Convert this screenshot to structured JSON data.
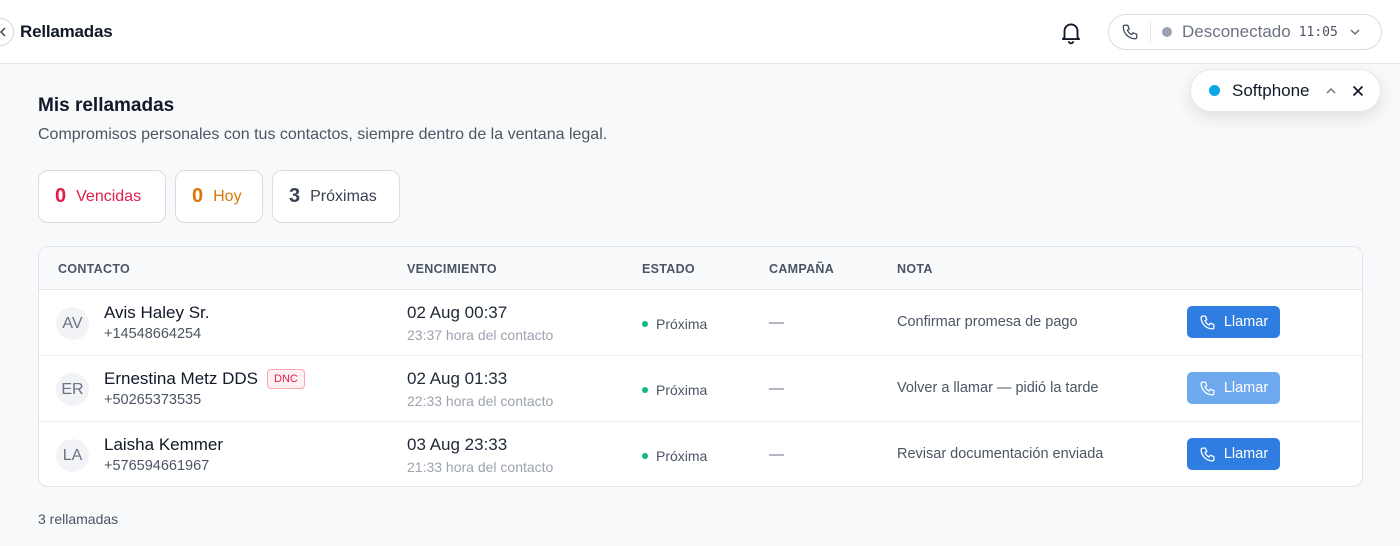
{
  "header": {
    "title": "Rellamadas",
    "connection_status": "Desconectado",
    "time": "11:05",
    "status_color": "#9aa3b2"
  },
  "softphone": {
    "label": "Softphone",
    "dot_color": "#0ea5e9"
  },
  "main": {
    "heading": "Mis rellamadas",
    "subtitle": "Compromisos personales con tus contactos, siempre dentro de la ventana legal."
  },
  "summary": [
    {
      "count": "0",
      "label": "Vencidas",
      "color": "#e11d48"
    },
    {
      "count": "0",
      "label": "Hoy",
      "color": "#d97706"
    },
    {
      "count": "3",
      "label": "Próximas",
      "color": "#374151"
    }
  ],
  "table": {
    "columns": {
      "contact": "CONTACTO",
      "due": "VENCIMIENTO",
      "status": "ESTADO",
      "campaign": "CAMPAÑA",
      "note": "NOTA"
    },
    "rows": [
      {
        "initials": "AV",
        "name": "Avis Haley Sr.",
        "dnc": "",
        "phone": "+14548664254",
        "due": "02 Aug 00:37",
        "local_time": "23:37 hora del contacto",
        "status": "Próxima",
        "campaign": "—",
        "note": "Confirmar promesa de pago",
        "action": "Llamar",
        "action_enabled": true
      },
      {
        "initials": "ER",
        "name": "Ernestina Metz DDS",
        "dnc": "DNC",
        "phone": "+50265373535",
        "due": "02 Aug 01:33",
        "local_time": "22:33 hora del contacto",
        "status": "Próxima",
        "campaign": "—",
        "note": "Volver a llamar — pidió la tarde",
        "action": "Llamar",
        "action_enabled": false
      },
      {
        "initials": "LA",
        "name": "Laisha Kemmer",
        "dnc": "",
        "phone": "+576594661967",
        "due": "03 Aug 23:33",
        "local_time": "21:33 hora del contacto",
        "status": "Próxima",
        "campaign": "—",
        "note": "Revisar documentación enviada",
        "action": "Llamar",
        "action_enabled": true
      }
    ]
  },
  "footer": {
    "count_label": "3 rellamadas"
  },
  "colors": {
    "primary_button": "#2f7de1",
    "status_dot": "#10b981"
  }
}
